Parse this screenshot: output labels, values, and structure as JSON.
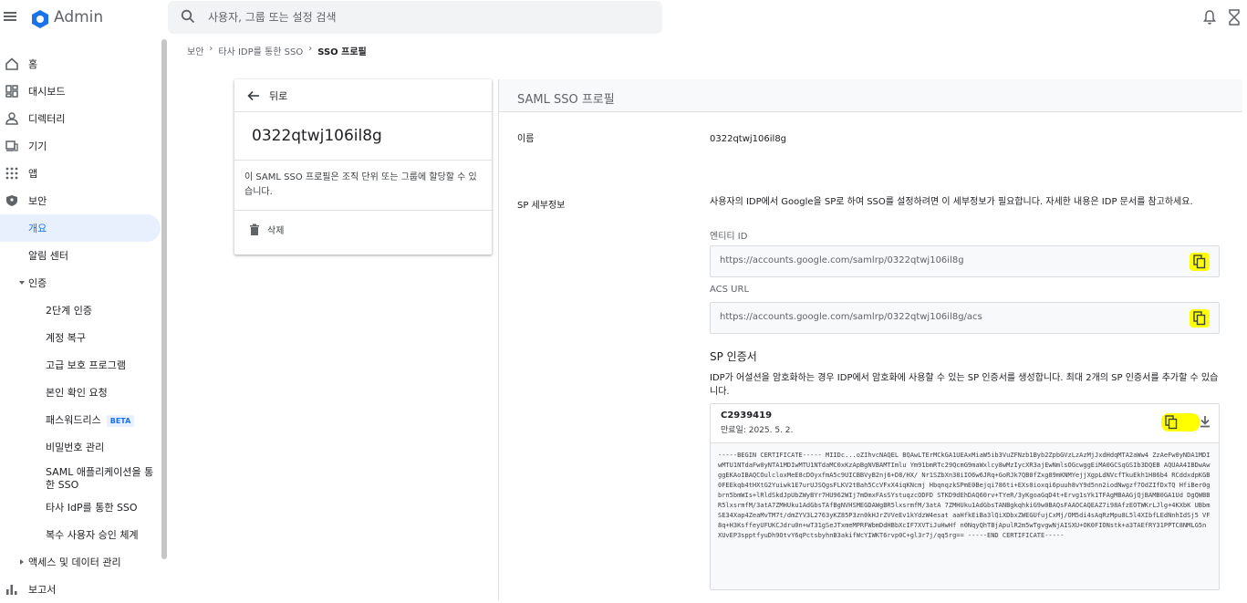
{
  "app": {
    "brand": "Admin"
  },
  "search": {
    "placeholder": "사용자, 그룹 또는 설정 검색"
  },
  "sidebar": {
    "items": [
      {
        "label": "홈",
        "icon": "home-icon"
      },
      {
        "label": "대시보드",
        "icon": "dashboard-icon"
      },
      {
        "label": "디렉터리",
        "icon": "person-icon"
      },
      {
        "label": "기기",
        "icon": "devices-icon"
      },
      {
        "label": "앱",
        "icon": "apps-grid-icon"
      },
      {
        "label": "보안",
        "icon": "shield-icon"
      },
      {
        "label": "개요"
      },
      {
        "label": "알림 센터"
      },
      {
        "label": "인증",
        "icon": "caret-down-icon"
      },
      {
        "label": "2단계 인증"
      },
      {
        "label": "계정 복구"
      },
      {
        "label": "고급 보호 프로그램"
      },
      {
        "label": "본인 확인 요청"
      },
      {
        "label": "패스워드리스",
        "badge": "BETA"
      },
      {
        "label": "비밀번호 관리"
      },
      {
        "label": "SAML 애플리케이션을 통한 SSO"
      },
      {
        "label": "타사 IdP를 통한 SSO"
      },
      {
        "label": "복수 사용자 승인 체계"
      },
      {
        "label": "액세스 및 데이터 관리",
        "icon": "caret-right-icon"
      },
      {
        "label": "보고서",
        "icon": "bar-chart-icon"
      }
    ]
  },
  "breadcrumb": {
    "items": [
      "보안",
      "타사 IDP를 통한 SSO",
      "SSO 프로필"
    ]
  },
  "left_card": {
    "back_label": "뒤로",
    "profile_id": "0322qtwj106il8g",
    "description": "이 SAML SSO 프로필은 조직 단위 또는 그룹에 할당할 수 있습니다.",
    "delete_label": "삭제"
  },
  "main": {
    "title": "SAML SSO 프로필",
    "name_label": "이름",
    "name_value": "0322qtwj106il8g",
    "sp_details_label": "SP 세부정보",
    "sp_details_desc": "사용자의 IDP에서 Google을 SP로 하여 SSO를 설정하려면 이 세부정보가 필요합니다. 자세한 내용은 IDP 문서를 참고하세요.",
    "entity_id_label": "엔티티 ID",
    "entity_id_value": "https://accounts.google.com/samlrp/0322qtwj106il8g",
    "acs_url_label": "ACS URL",
    "acs_url_value": "https://accounts.google.com/samlrp/0322qtwj106il8g/acs",
    "sp_cert_title": "SP 인증서",
    "sp_cert_desc": "IDP가 어설션을 암호화하는 경우 IDP에서 암호화에 사용할 수 있는 SP 인증서를 생성합니다. 최대 2개의 SP 인증서를 추가할 수 있습니다.",
    "cert": {
      "name": "C2939419",
      "expiry": "만료일: 2025. 5. 2.",
      "body": "-----BEGIN CERTIFICATE----- MIIDc...oZIhvcNAQEL BQAwLTErMCkGA1UEAxMiaW5ib3VuZFNzb1Byb2ZpbGVzLzAzMjJxdHdqMTA2aWw4 ZzAeFw0yNDA1MDIwMTU1NTdaFw0yNTA1MDIwMTU1NTdaMC0xKzApBgNVBAMTImlu Ym91bmRTc29QcmG9maWxlcy8wMzIycXR3ajEwNmlsOGcwggEiMA0GCSqGSIb3DQEB AQUAA4IBDwAwggEKAoIBAQCOulcloxMeE8cDOyxfmA5c9UICBBVyB2nj6+D8/HX/ Nr1SZbXn38iIO6w6JRq+GoRJk7QB0fZxg89mKNMYejjXgpLdNVcfTkuEkh1H86b4 RCddxdpKGB0FEEkqb4tHXtG2Yuiwk1E7urUJSQgsFLKV2tBah5CcVFxX4iqKNcmj HbqnqzkSPmE0Bejqi786ti+EXs0ioxqi6puuh8vY9d5nn2iodNwgzf7OdZIfDxTQ HfiBer0gbrn5bmWIs+lRldSkdJpUbZWyBYr7HU962WIj7mDmxFAsSYstuqzcODFD STKD9dEhDAQ60rv+TYeR/3yKgoaGqD4t+Ervg1sYk1TFAgMBAAGjQjBAMB0GA1Ud DgQWBBR5lxsrmfM/3atA7ZMHUku1AdGbsTAfBgNVHSMEGDAWgBR5lxsrmfM/3atA 7ZMHUku1AdGbsTANBgkqhkiG9w0BAQsFAAOCAQEAZ7i98AfzEOTWKrLJlg+4KXbK UBbmSE34Xap4ZeaMvTM7t/dmZYV3L2763yKZ85P3zn0kHJrZVVeEv1kYdzW4esat aaHfkEiBa3lQiXDbxZWEGUfujCxMj/OM5di4sAqRzMpu8L5l4XIbfLEdNnhIdSj5 VF8q+H3KsffeyUFUKCJdru0n+wT31gSeJTxmeMPRFWbmDdHBbXcIF7XVTiJuHwHf n0NqyQhTBjApulR2m5wTgvgwNjAISXU+OK0FIONstk+a3TAEfRY31PPTC8NMLG5n XUvEP3spptfyuDh9OtvY6qPctsbyhnB3akifWcYIWKT6rvp0C+gl3r7j/qq5rg== -----END CERTIFICATE-----"
    }
  }
}
